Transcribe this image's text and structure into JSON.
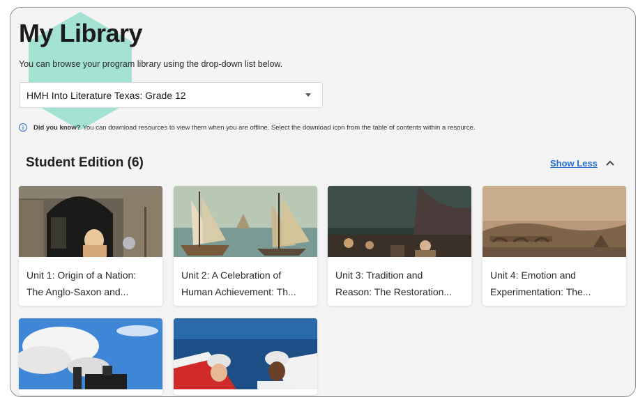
{
  "page": {
    "title": "My Library",
    "subtitle": "You can browse your program library using the drop-down list below."
  },
  "program_select": {
    "value": "HMH Into Literature Texas: Grade 12"
  },
  "tip": {
    "bold": "Did you know?",
    "text": "You can download resources to view them when you are offline. Select the download icon from the table of contents within a resource."
  },
  "section": {
    "title": "Student Edition (6)",
    "toggle_label": "Show Less"
  },
  "units": [
    {
      "line1": "Unit 1: Origin of a Nation:",
      "line2": "The Anglo-Saxon and..."
    },
    {
      "line1": "Unit 2: A Celebration of",
      "line2": "Human Achievement: Th..."
    },
    {
      "line1": "Unit 3: Tradition and",
      "line2": "Reason: The Restoration..."
    },
    {
      "line1": "Unit 4: Emotion and",
      "line2": "Experimentation: The..."
    }
  ],
  "colors": {
    "accent_hex": "#a4e2d4",
    "link": "#1f6fd6",
    "info": "#2a6fd0"
  },
  "icons": [
    "info-icon",
    "caret-down-icon",
    "chevron-up-icon"
  ]
}
